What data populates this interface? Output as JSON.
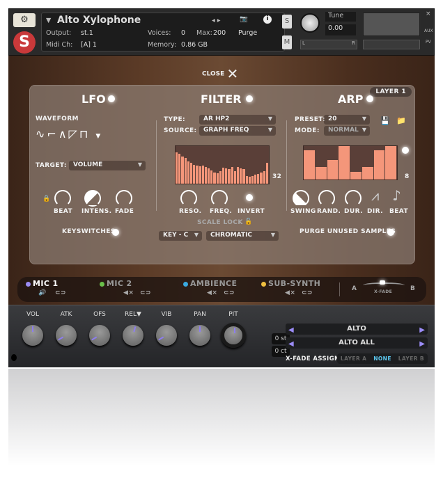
{
  "header": {
    "title": "Alto Xylophone",
    "output_label": "Output:",
    "output": "st.1",
    "midi_label": "Midi Ch:",
    "midi": "[A] 1",
    "voices_label": "Voices:",
    "voices": "0",
    "max_label": "Max:",
    "max": "200",
    "memory_label": "Memory:",
    "memory": "0.86 GB",
    "purge": "Purge",
    "tune_label": "Tune",
    "tune": "0.00",
    "solo": "S",
    "mute": "M",
    "pan_l": "L",
    "pan_r": "R",
    "aux": "AUX",
    "pv": "PV"
  },
  "close_label": "CLOSE",
  "layer": "LAYER 1",
  "lfo": {
    "title": "LFO",
    "waveform_label": "WAVEFORM",
    "target_label": "TARGET:",
    "target": "VOLUME",
    "knobs": [
      "BEAT",
      "INTENS.",
      "FADE"
    ],
    "keyswitches": "KEYSWITCHES"
  },
  "filter": {
    "title": "FILTER",
    "type_label": "TYPE:",
    "type": "AR HP2",
    "source_label": "SOURCE:",
    "source": "GRAPH FREQ",
    "steps": "32",
    "graph_values": [
      0.83,
      0.8,
      0.72,
      0.68,
      0.6,
      0.55,
      0.5,
      0.48,
      0.46,
      0.48,
      0.44,
      0.4,
      0.36,
      0.3,
      0.27,
      0.34,
      0.42,
      0.4,
      0.38,
      0.44,
      0.34,
      0.44,
      0.4,
      0.38,
      0.2,
      0.18,
      0.2,
      0.24,
      0.26,
      0.3,
      0.34,
      0.55
    ],
    "knobs": [
      "RESO.",
      "FREQ.",
      "INVERT"
    ],
    "scale_lock": "SCALE LOCK",
    "key": "KEY - C",
    "scale": "CHROMATIC"
  },
  "arp": {
    "title": "ARP",
    "preset_label": "PRESET:",
    "preset": "20",
    "mode_label": "MODE:",
    "mode": "NORMAL",
    "steps": "8",
    "graph_values": [
      0.88,
      0.38,
      0.58,
      1.0,
      0.22,
      0.37,
      0.88,
      1.0
    ],
    "knobs": [
      "SWING",
      "RAND.",
      "DUR.",
      "DIR.",
      "BEAT"
    ],
    "purge": "PURGE UNUSED SAMPLES"
  },
  "mics": [
    {
      "name": "MIC 1",
      "color": "#9a8cf5",
      "active": true
    },
    {
      "name": "MIC 2",
      "color": "#6ac04a",
      "active": false
    },
    {
      "name": "AMBIENCE",
      "color": "#3aa9e0",
      "active": false
    },
    {
      "name": "SUB-SYNTH",
      "color": "#f0c040",
      "active": false
    }
  ],
  "xfade": {
    "a": "A",
    "b": "B",
    "label": "X-FADE"
  },
  "bottom": {
    "knobs": [
      {
        "label": "VOL",
        "angle": 0
      },
      {
        "label": "ATK",
        "angle": -120
      },
      {
        "label": "OFS",
        "angle": -120
      },
      {
        "label": "REL▼",
        "angle": 15
      },
      {
        "label": "VIB",
        "angle": -120
      },
      {
        "label": "PAN",
        "angle": 0
      },
      {
        "label": "PIT",
        "angle": 0
      }
    ],
    "semitone": "0 st",
    "cent": "0 ct",
    "select1": "ALTO",
    "select2": "ALTO ALL",
    "xfade_assign": "X-FADE ASSIGN",
    "assign_options": [
      "LAYER A",
      "NONE",
      "LAYER B"
    ],
    "assign_selected": "NONE",
    "accent": "#9b8cf6"
  }
}
